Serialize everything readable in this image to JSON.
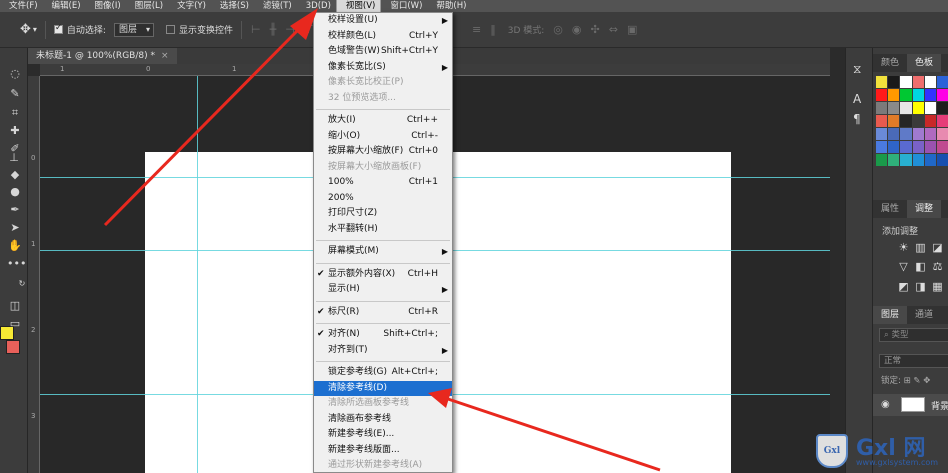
{
  "menubar": {
    "items": [
      "文件(F)",
      "编辑(E)",
      "图像(I)",
      "图层(L)",
      "文字(Y)",
      "选择(S)",
      "滤镜(T)",
      "3D(D)",
      "视图(V)",
      "窗口(W)",
      "帮助(H)"
    ]
  },
  "options": {
    "auto_select_label": "自动选择:",
    "auto_select_value": "图层",
    "transform_label": "显示变换控件",
    "mode_3d_label": "3D 模式:"
  },
  "document": {
    "tab_title": "未标题-1 @ 100%(RGB/8) *",
    "close": "×"
  },
  "rulers": {
    "top_ticks": [
      "1",
      "0",
      "1"
    ],
    "left_ticks": [
      "0",
      "1",
      "2",
      "3"
    ]
  },
  "view_menu": {
    "items": [
      {
        "label": "校样设置(U)",
        "shortcut": "",
        "arrow": true,
        "disabled": false,
        "check": false
      },
      {
        "label": "校样颜色(L)",
        "shortcut": "Ctrl+Y",
        "arrow": false,
        "disabled": false,
        "check": false
      },
      {
        "label": "色域警告(W)",
        "shortcut": "Shift+Ctrl+Y",
        "arrow": false,
        "disabled": false,
        "check": false
      },
      {
        "label": "像素长宽比(S)",
        "shortcut": "",
        "arrow": true,
        "disabled": false,
        "check": false
      },
      {
        "label": "像素长宽比校正(P)",
        "shortcut": "",
        "arrow": false,
        "disabled": true,
        "check": false
      },
      {
        "label": "32 位预览选项...",
        "shortcut": "",
        "arrow": false,
        "disabled": true,
        "check": false
      },
      {
        "sep": true
      },
      {
        "label": "放大(I)",
        "shortcut": "Ctrl++",
        "arrow": false,
        "disabled": false,
        "check": false
      },
      {
        "label": "缩小(O)",
        "shortcut": "Ctrl+-",
        "arrow": false,
        "disabled": false,
        "check": false
      },
      {
        "label": "按屏幕大小缩放(F)",
        "shortcut": "Ctrl+0",
        "arrow": false,
        "disabled": false,
        "check": false
      },
      {
        "label": "按屏幕大小缩放画板(F)",
        "shortcut": "",
        "arrow": false,
        "disabled": true,
        "check": false
      },
      {
        "label": "100%",
        "shortcut": "Ctrl+1",
        "arrow": false,
        "disabled": false,
        "check": false
      },
      {
        "label": "200%",
        "shortcut": "",
        "arrow": false,
        "disabled": false,
        "check": false
      },
      {
        "label": "打印尺寸(Z)",
        "shortcut": "",
        "arrow": false,
        "disabled": false,
        "check": false
      },
      {
        "label": "水平翻转(H)",
        "shortcut": "",
        "arrow": false,
        "disabled": false,
        "check": false
      },
      {
        "sep": true
      },
      {
        "label": "屏幕模式(M)",
        "shortcut": "",
        "arrow": true,
        "disabled": false,
        "check": false
      },
      {
        "sep": true
      },
      {
        "label": "显示额外内容(X)",
        "shortcut": "Ctrl+H",
        "arrow": false,
        "disabled": false,
        "check": true
      },
      {
        "label": "显示(H)",
        "shortcut": "",
        "arrow": true,
        "disabled": false,
        "check": false
      },
      {
        "sep": true
      },
      {
        "label": "标尺(R)",
        "shortcut": "Ctrl+R",
        "arrow": false,
        "disabled": false,
        "check": true
      },
      {
        "sep": true
      },
      {
        "label": "对齐(N)",
        "shortcut": "Shift+Ctrl+;",
        "arrow": false,
        "disabled": false,
        "check": true
      },
      {
        "label": "对齐到(T)",
        "shortcut": "",
        "arrow": true,
        "disabled": false,
        "check": false
      },
      {
        "sep": true
      },
      {
        "label": "锁定参考线(G)",
        "shortcut": "Alt+Ctrl+;",
        "arrow": false,
        "disabled": false,
        "check": false
      },
      {
        "label": "清除参考线(D)",
        "shortcut": "",
        "arrow": false,
        "disabled": false,
        "check": false,
        "highlight": true
      },
      {
        "label": "清除所选画板参考线",
        "shortcut": "",
        "arrow": false,
        "disabled": true,
        "check": false
      },
      {
        "label": "清除画布参考线",
        "shortcut": "",
        "arrow": false,
        "disabled": false,
        "check": false
      },
      {
        "label": "新建参考线(E)...",
        "shortcut": "",
        "arrow": false,
        "disabled": false,
        "check": false
      },
      {
        "label": "新建参考线版面...",
        "shortcut": "",
        "arrow": false,
        "disabled": false,
        "check": false
      },
      {
        "label": "通过形状新建参考线(A)",
        "shortcut": "",
        "arrow": false,
        "disabled": true,
        "check": false
      }
    ]
  },
  "panels": {
    "color_tabs": [
      "颜色",
      "色板"
    ],
    "props_tabs": [
      "属性",
      "调整"
    ],
    "add_adjustment": "添加调整",
    "layers_tabs": [
      "图层",
      "通道"
    ],
    "search_placeholder": "类型",
    "blend_mode": "正常",
    "lock_label": "锁定:",
    "layer_name": "背景"
  },
  "right_strip": {
    "char_label": "A"
  },
  "swatches": [
    [
      "#f2e23c",
      "#1a1a1a",
      "#ffffff",
      "#f06e6e",
      "#ffffff",
      "#2b62d9"
    ],
    [
      "#ff1a1a",
      "#ff9900",
      "#00c832",
      "#00d7e0",
      "#3232ff",
      "#ff00e6"
    ],
    [
      "#7a7a7a",
      "#8a8a8a",
      "#e6e6e6",
      "#ffff00",
      "#ffffff",
      "#1e1e1e"
    ],
    [
      "#e85a4f",
      "#e07b28",
      "#262626",
      "#3a3a3a",
      "#c82828",
      "#e63c78"
    ],
    [
      "#6a8ad8",
      "#4a6ab8",
      "#5f7ac8",
      "#a07ad0",
      "#b06ac0",
      "#e88ab0"
    ],
    [
      "#4a7ae0",
      "#2f64c8",
      "#5a6ad0",
      "#7a62c8",
      "#9a52b0",
      "#c04a90"
    ],
    [
      "#1a9a4a",
      "#2fb07a",
      "#28b0d0",
      "#2090d8",
      "#2068c8",
      "#1850b0"
    ]
  ],
  "watermark": {
    "shield": "Gxl",
    "name": "Gxl 网",
    "url": "www.gxlsystem.com"
  },
  "colors": {
    "guide": "#5fd4dc",
    "highlight": "#1c6fd0",
    "arrow": "#e8281e"
  }
}
